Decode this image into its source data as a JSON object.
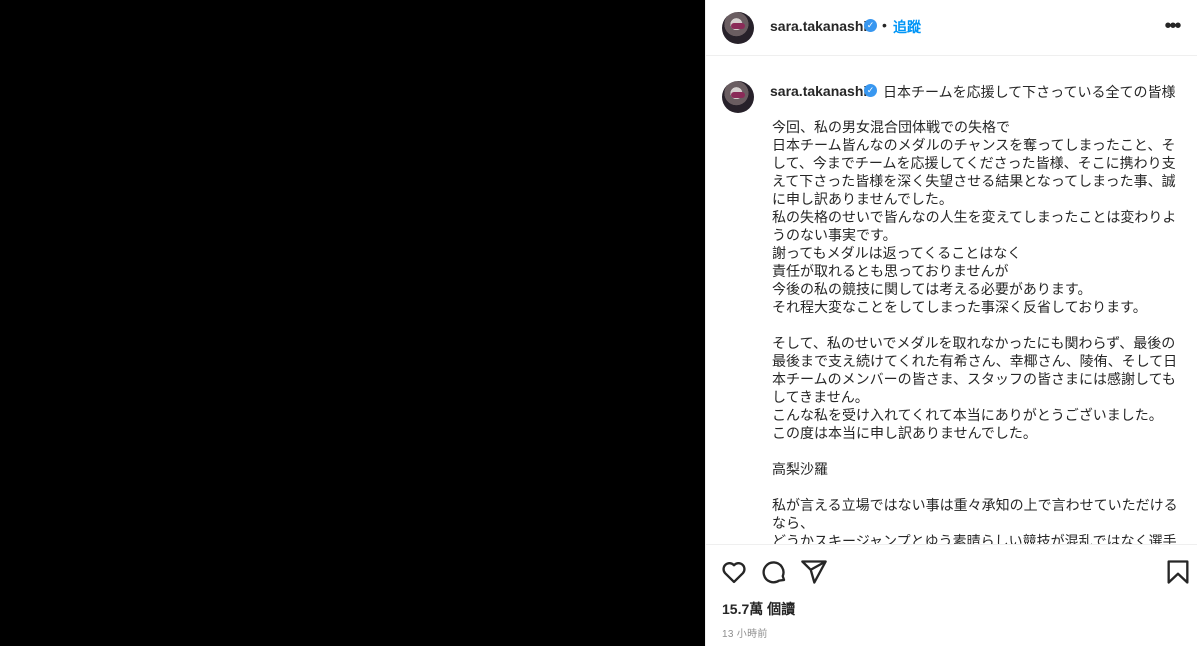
{
  "post": {
    "username": "sara.takanashi",
    "verified_mark": "✓",
    "follow_label": "追蹤",
    "dot": "•",
    "more_icon": "more-horizontal-icon"
  },
  "caption": {
    "username": "sara.takanashi",
    "first_line": "日本チームを応援して下さっている全ての皆様",
    "body": "今回、私の男女混合団体戦での失格で\n日本チーム皆んなのメダルのチャンスを奪ってしまったこと、そして、今までチームを応援してくださった皆様、そこに携わり支えて下さった皆様を深く失望させる結果となってしまった事、誠に申し訳ありませんでした。\n私の失格のせいで皆んなの人生を変えてしまったことは変わりようのない事実です。\n謝ってもメダルは返ってくることはなく\n責任が取れるとも思っておりませんが\n今後の私の競技に関しては考える必要があります。\nそれ程大変なことをしてしまった事深く反省しております。\n\nそして、私のせいでメダルを取れなかったにも関わらず、最後の最後まで支え続けてくれた有希さん、幸椰さん、陵侑、そして日本チームのメンバーの皆さま、スタッフの皆さまには感謝してもしてきません。\nこんな私を受け入れてくれて本当にありがとうございました。\nこの度は本当に申し訳ありませんでした。\n\n高梨沙羅\n\n私が言える立場ではない事は重々承知の上で言わせていただけるなら、\nどうかスキージャンプとゆう素晴らしい競技が混乱ではなく選手"
  },
  "actions": {
    "like_icon": "heart-icon",
    "comment_icon": "comment-icon",
    "share_icon": "paper-plane-icon",
    "save_icon": "bookmark-icon"
  },
  "stats": {
    "views": "15.7萬 個讀",
    "time": "13 小時前"
  }
}
